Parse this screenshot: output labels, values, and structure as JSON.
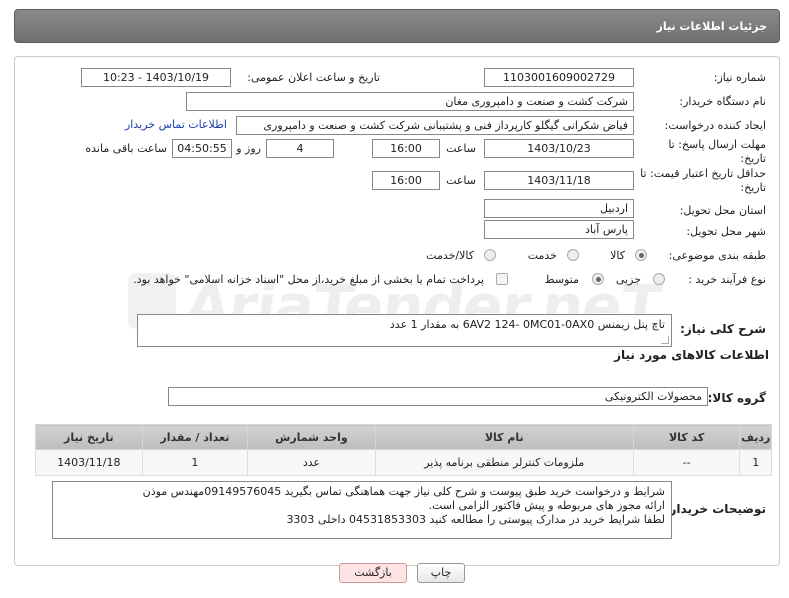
{
  "header": {
    "title": "جزئیات اطلاعات نیاز"
  },
  "form": {
    "need_number": {
      "label": "شماره نیاز:",
      "value": "1103001609002729"
    },
    "announce_datetime": {
      "label": "تاریخ و ساعت اعلان عمومی:",
      "value": "1403/10/19 - 10:23"
    },
    "buyer_org": {
      "label": "نام دستگاه خریدار:",
      "value": "شرکت کشت و صنعت و دامپروری مغان"
    },
    "requester": {
      "label": "ایجاد کننده درخواست:",
      "value": "فیاض شکرانی گیگلو کارپرداز فنی و پشتیبانی شرکت کشت و صنعت و دامپروری",
      "contact_link": "اطلاعات تماس خریدار"
    },
    "reply_deadline": {
      "label_line1": "مهلت ارسال پاسخ: تا",
      "label_line2": "تاریخ:",
      "date": "1403/10/23",
      "time_label": "ساعت",
      "time": "16:00",
      "days": "4",
      "days_label": "روز و",
      "remaining": "04:50:55",
      "remaining_label": "ساعت باقی مانده"
    },
    "price_validity": {
      "label_line1": "حداقل تاریخ اعتبار قیمت: تا",
      "label_line2": "تاریخ:",
      "date": "1403/11/18",
      "time_label": "ساعت",
      "time": "16:00"
    },
    "province": {
      "label": "استان محل تحویل:",
      "value": "اردبیل"
    },
    "city": {
      "label": "شهر محل تحویل:",
      "value": "پارس آباد"
    },
    "category": {
      "label": "طبقه بندی موضوعی:",
      "options": [
        "کالا",
        "خدمت",
        "کالا/خدمت"
      ],
      "selected": "کالا"
    },
    "process_type": {
      "label": "نوع فرآیند خرید :",
      "options": [
        "جزیی",
        "متوسط"
      ],
      "selected": "متوسط",
      "payment_note": "پرداخت تمام یا بخشی از مبلغ خرید،از محل \"اسناد خزانه اسلامی\" خواهد بود."
    }
  },
  "general_description": {
    "label": "شرح کلی نیاز:",
    "value": "تاچ پنل زیمنس  6AV2 124- 0MC01-0AX0  به مقدار 1 عدد"
  },
  "items_section": {
    "title": "اطلاعات کالاهای مورد نیاز"
  },
  "goods_group": {
    "label": "گروه کالا:",
    "value": "محصولات الکترونیکی"
  },
  "table": {
    "headers": [
      "ردیف",
      "کد کالا",
      "نام کالا",
      "واحد شمارش",
      "تعداد / مقدار",
      "تاریخ نیاز"
    ],
    "rows": [
      [
        "1",
        "--",
        "ملزومات کنترلر منطقی برنامه پذیر",
        "عدد",
        "1",
        "1403/11/18"
      ]
    ]
  },
  "buyer_notes": {
    "label": "توضیحات خریدار:",
    "lines": [
      "شرایط و درخواست خرید طبق پیوست و شرح کلی نیاز  جهت هماهنگی تماس بگیرید  09149576045مهندس موذن",
      "ارائه مجوز های مربوطه و پیش فاکتور الزامی است.",
      "لطفا شرایط خرید در مدارک پیوستی را مطالعه کنید  04531853303   داخلی  3303"
    ]
  },
  "buttons": {
    "print": "چاپ",
    "back": "بازگشت"
  },
  "watermark": {
    "text": "AriaTender.neT"
  },
  "colors": {
    "header_bg": "#7a7a7a",
    "link": "#1a3fb0",
    "back_button_bg": "#fde3e3"
  }
}
